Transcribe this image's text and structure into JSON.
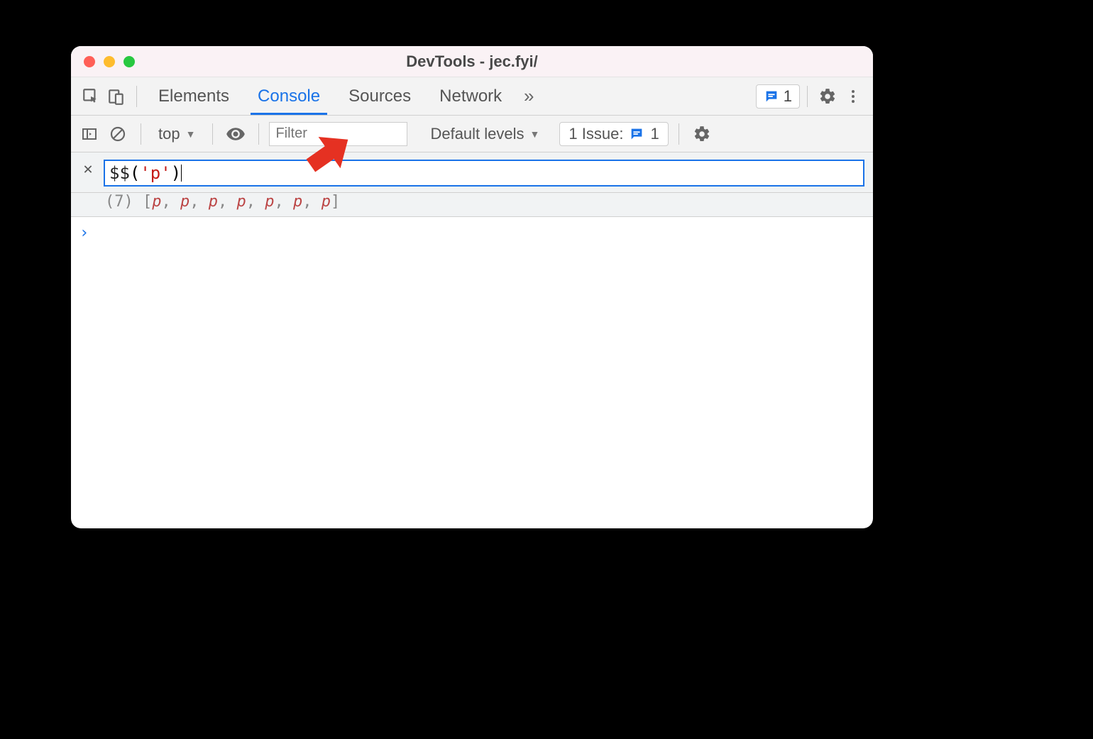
{
  "window": {
    "title": "DevTools - jec.fyi/"
  },
  "tabs": {
    "elements": "Elements",
    "console": "Console",
    "sources": "Sources",
    "network": "Network",
    "more_icon": "»",
    "messages_count": "1"
  },
  "console_toolbar": {
    "context": "top",
    "filter_placeholder": "Filter",
    "levels": "Default levels",
    "issues_label": "1 Issue:",
    "issues_count": "1"
  },
  "eager_eval": {
    "code_fn": "$$",
    "code_open": "(",
    "code_str": "'p'",
    "code_close": ")",
    "preview_len": "(7)",
    "preview_open": "[",
    "preview_items": [
      "p",
      "p",
      "p",
      "p",
      "p",
      "p",
      "p"
    ],
    "preview_close": "]"
  },
  "prompt": {
    "chevron": "›"
  }
}
